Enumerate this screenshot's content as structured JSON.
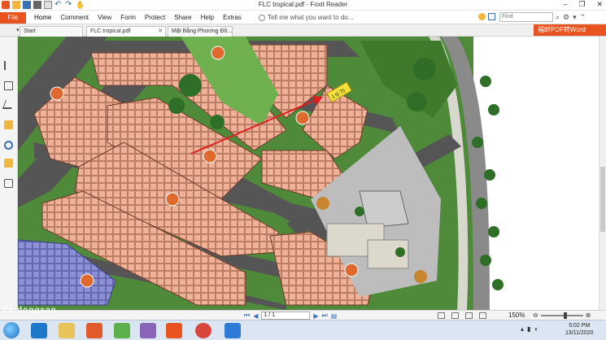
{
  "window": {
    "title": "FLC tropical.pdf - Foxit Reader",
    "controls": [
      "–",
      "❐",
      "✕"
    ]
  },
  "menu": {
    "file": "File",
    "items": [
      "Home",
      "Comment",
      "View",
      "Form",
      "Protect",
      "Share",
      "Help",
      "Extras"
    ],
    "tell_me": "Tell me what you want to do...",
    "find_placeholder": "Find"
  },
  "tabs": [
    {
      "label": "Start"
    },
    {
      "label": "FLC tropical.pdf"
    },
    {
      "label": "Mặt Bằng Phương Đô..."
    }
  ],
  "promo": "福昕PDF转Word",
  "map": {
    "price_label": "1 tỷ 75"
  },
  "status": {
    "page": "1 / 1",
    "zoom": "150%"
  },
  "clock": {
    "time": "5:02 PM",
    "date": "13/11/2020"
  },
  "watermark": "Batdongsan"
}
